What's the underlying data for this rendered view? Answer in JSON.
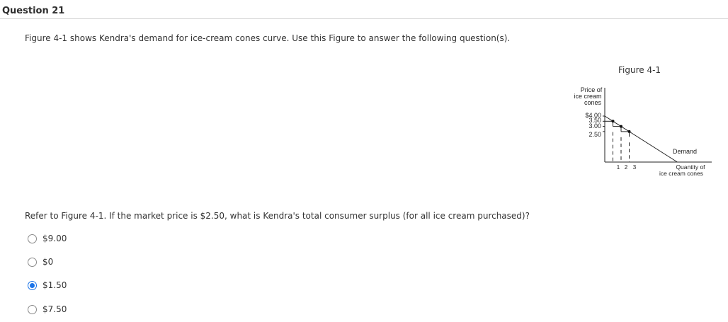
{
  "question": {
    "title": "Question 21",
    "intro": "Figure 4-1 shows Kendra's demand for ice-cream cones curve. Use this Figure to answer the following question(s).",
    "prompt": "Refer to Figure 4-1. If the market price is $2.50, what is Kendra's total consumer surplus (for all ice cream purchased)?"
  },
  "figure": {
    "caption": "Figure 4-1",
    "y_label_lines": [
      "Price of",
      "ice cream",
      "cones"
    ],
    "x_label_lines": [
      "Quantity of",
      "ice cream cones"
    ],
    "curve_label": "Demand",
    "y_ticks": [
      "$4.00",
      "3.50",
      "3.00",
      "2.50"
    ],
    "x_ticks": [
      "1",
      "2",
      "3"
    ]
  },
  "chart_data": {
    "type": "line",
    "xlabel": "Quantity of ice cream cones",
    "ylabel": "Price of ice cream cones",
    "series": [
      {
        "name": "Demand",
        "x": [
          0,
          1,
          2,
          3,
          9.6
        ],
        "y": [
          4.0,
          3.5,
          3.0,
          2.5,
          -0.8
        ]
      }
    ],
    "marked_points": [
      {
        "x": 1,
        "y": 3.5
      },
      {
        "x": 2,
        "y": 3.0
      },
      {
        "x": 3,
        "y": 2.5
      }
    ],
    "grid": false
  },
  "options": [
    {
      "label": "$9.00",
      "selected": false
    },
    {
      "label": "$0",
      "selected": false
    },
    {
      "label": "$1.50",
      "selected": true
    },
    {
      "label": "$7.50",
      "selected": false
    }
  ],
  "colors": {
    "accent": "#1a73e8"
  }
}
